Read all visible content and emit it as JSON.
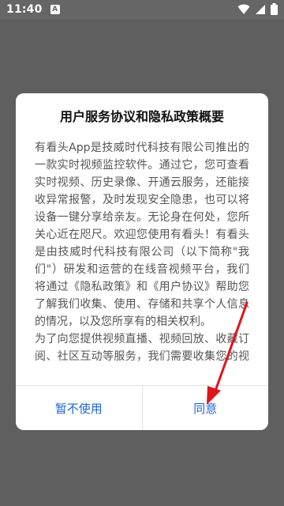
{
  "status_bar": {
    "time": "11:40",
    "notification_badge": "A"
  },
  "dialog": {
    "title": "用户服务协议和隐私政策概要",
    "paragraphs": [
      "有看头App是技威时代科技有限公司推出的一款实时视频监控软件。通过它，您可查看实时视频、历史录像、开通云服务，还能接收异常报警，及时发现安全隐患，也可以将设备一键分享给亲友。无论身在何处，您所关心近在咫尺。欢迎您使用有看头！有看头是由技威时代科技有限公司（以下简称\"我们\"）研发和运营的在线音视频平台，我们将通过《隐私政策》和《用户协议》帮助您了解我们收集、使用、存储和共享个人信息的情况，以及您所享有的相关权利。",
      "为了向您提供视频直播、视频回放、收藏订阅、社区互动等服务，我们需要收集您的视频录像、视频图片、设备信息、操作日志等个人信息；"
    ],
    "cancel_label": "暂不使用",
    "agree_label": "同意"
  },
  "colors": {
    "button_text": "#1e63d6",
    "annotation_arrow": "#e0141b"
  }
}
